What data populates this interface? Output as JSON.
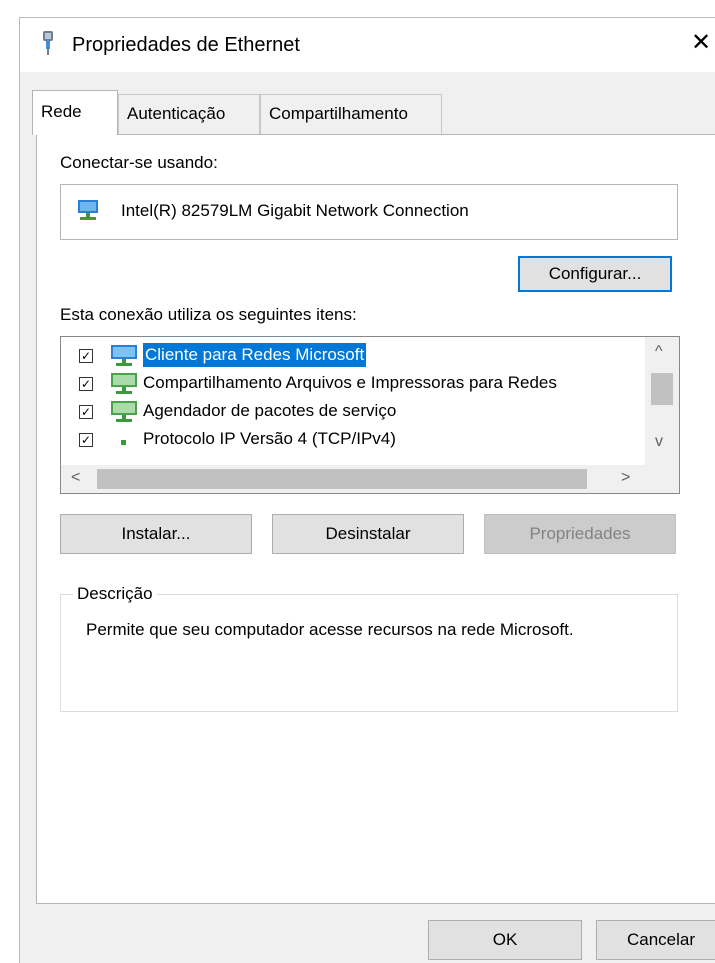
{
  "window": {
    "title": "Propriedades de Ethernet",
    "close_glyph": "✕"
  },
  "tabs": [
    {
      "label": "Rede",
      "active": true
    },
    {
      "label": "Autenticação",
      "active": false
    },
    {
      "label": "Compartilhamento",
      "active": false
    }
  ],
  "connect": {
    "label": "Conectar-se usando:",
    "adapter": "Intel(R) 82579LM Gigabit Network Connection",
    "configure_button": "Configurar..."
  },
  "items": {
    "label": "Esta conexão utiliza os seguintes itens:",
    "list": [
      {
        "label": "Cliente para Redes Microsoft",
        "checked": true,
        "selected": true,
        "icon": "network-client-icon"
      },
      {
        "label": "Compartilhamento Arquivos e Impressoras para Redes",
        "checked": true,
        "selected": false,
        "icon": "network-service-icon"
      },
      {
        "label": "Agendador de pacotes de serviço",
        "checked": true,
        "selected": false,
        "icon": "network-service-icon"
      },
      {
        "label": "Protocolo IP Versão 4 (TCP/IPv4)",
        "checked": true,
        "selected": false,
        "icon": "protocol-icon"
      }
    ]
  },
  "buttons": {
    "install": "Instalar...",
    "uninstall": "Desinstalar",
    "properties": "Propriedades"
  },
  "description": {
    "legend": "Descrição",
    "text": "Permite que seu computador acesse recursos na rede Microsoft."
  },
  "footer": {
    "ok": "OK",
    "cancel": "Cancelar"
  },
  "colors": {
    "selection": "#0078d7",
    "focus_border": "#0078d7"
  }
}
